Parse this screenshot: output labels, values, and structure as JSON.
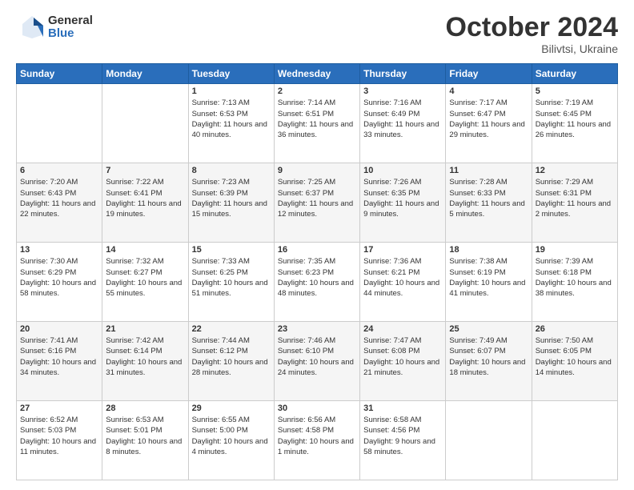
{
  "header": {
    "logo_general": "General",
    "logo_blue": "Blue",
    "title": "October 2024",
    "location": "Bilivtsi, Ukraine"
  },
  "weekdays": [
    "Sunday",
    "Monday",
    "Tuesday",
    "Wednesday",
    "Thursday",
    "Friday",
    "Saturday"
  ],
  "weeks": [
    [
      {
        "day": "",
        "info": ""
      },
      {
        "day": "",
        "info": ""
      },
      {
        "day": "1",
        "info": "Sunrise: 7:13 AM\nSunset: 6:53 PM\nDaylight: 11 hours and 40 minutes."
      },
      {
        "day": "2",
        "info": "Sunrise: 7:14 AM\nSunset: 6:51 PM\nDaylight: 11 hours and 36 minutes."
      },
      {
        "day": "3",
        "info": "Sunrise: 7:16 AM\nSunset: 6:49 PM\nDaylight: 11 hours and 33 minutes."
      },
      {
        "day": "4",
        "info": "Sunrise: 7:17 AM\nSunset: 6:47 PM\nDaylight: 11 hours and 29 minutes."
      },
      {
        "day": "5",
        "info": "Sunrise: 7:19 AM\nSunset: 6:45 PM\nDaylight: 11 hours and 26 minutes."
      }
    ],
    [
      {
        "day": "6",
        "info": "Sunrise: 7:20 AM\nSunset: 6:43 PM\nDaylight: 11 hours and 22 minutes."
      },
      {
        "day": "7",
        "info": "Sunrise: 7:22 AM\nSunset: 6:41 PM\nDaylight: 11 hours and 19 minutes."
      },
      {
        "day": "8",
        "info": "Sunrise: 7:23 AM\nSunset: 6:39 PM\nDaylight: 11 hours and 15 minutes."
      },
      {
        "day": "9",
        "info": "Sunrise: 7:25 AM\nSunset: 6:37 PM\nDaylight: 11 hours and 12 minutes."
      },
      {
        "day": "10",
        "info": "Sunrise: 7:26 AM\nSunset: 6:35 PM\nDaylight: 11 hours and 9 minutes."
      },
      {
        "day": "11",
        "info": "Sunrise: 7:28 AM\nSunset: 6:33 PM\nDaylight: 11 hours and 5 minutes."
      },
      {
        "day": "12",
        "info": "Sunrise: 7:29 AM\nSunset: 6:31 PM\nDaylight: 11 hours and 2 minutes."
      }
    ],
    [
      {
        "day": "13",
        "info": "Sunrise: 7:30 AM\nSunset: 6:29 PM\nDaylight: 10 hours and 58 minutes."
      },
      {
        "day": "14",
        "info": "Sunrise: 7:32 AM\nSunset: 6:27 PM\nDaylight: 10 hours and 55 minutes."
      },
      {
        "day": "15",
        "info": "Sunrise: 7:33 AM\nSunset: 6:25 PM\nDaylight: 10 hours and 51 minutes."
      },
      {
        "day": "16",
        "info": "Sunrise: 7:35 AM\nSunset: 6:23 PM\nDaylight: 10 hours and 48 minutes."
      },
      {
        "day": "17",
        "info": "Sunrise: 7:36 AM\nSunset: 6:21 PM\nDaylight: 10 hours and 44 minutes."
      },
      {
        "day": "18",
        "info": "Sunrise: 7:38 AM\nSunset: 6:19 PM\nDaylight: 10 hours and 41 minutes."
      },
      {
        "day": "19",
        "info": "Sunrise: 7:39 AM\nSunset: 6:18 PM\nDaylight: 10 hours and 38 minutes."
      }
    ],
    [
      {
        "day": "20",
        "info": "Sunrise: 7:41 AM\nSunset: 6:16 PM\nDaylight: 10 hours and 34 minutes."
      },
      {
        "day": "21",
        "info": "Sunrise: 7:42 AM\nSunset: 6:14 PM\nDaylight: 10 hours and 31 minutes."
      },
      {
        "day": "22",
        "info": "Sunrise: 7:44 AM\nSunset: 6:12 PM\nDaylight: 10 hours and 28 minutes."
      },
      {
        "day": "23",
        "info": "Sunrise: 7:46 AM\nSunset: 6:10 PM\nDaylight: 10 hours and 24 minutes."
      },
      {
        "day": "24",
        "info": "Sunrise: 7:47 AM\nSunset: 6:08 PM\nDaylight: 10 hours and 21 minutes."
      },
      {
        "day": "25",
        "info": "Sunrise: 7:49 AM\nSunset: 6:07 PM\nDaylight: 10 hours and 18 minutes."
      },
      {
        "day": "26",
        "info": "Sunrise: 7:50 AM\nSunset: 6:05 PM\nDaylight: 10 hours and 14 minutes."
      }
    ],
    [
      {
        "day": "27",
        "info": "Sunrise: 6:52 AM\nSunset: 5:03 PM\nDaylight: 10 hours and 11 minutes."
      },
      {
        "day": "28",
        "info": "Sunrise: 6:53 AM\nSunset: 5:01 PM\nDaylight: 10 hours and 8 minutes."
      },
      {
        "day": "29",
        "info": "Sunrise: 6:55 AM\nSunset: 5:00 PM\nDaylight: 10 hours and 4 minutes."
      },
      {
        "day": "30",
        "info": "Sunrise: 6:56 AM\nSunset: 4:58 PM\nDaylight: 10 hours and 1 minute."
      },
      {
        "day": "31",
        "info": "Sunrise: 6:58 AM\nSunset: 4:56 PM\nDaylight: 9 hours and 58 minutes."
      },
      {
        "day": "",
        "info": ""
      },
      {
        "day": "",
        "info": ""
      }
    ]
  ]
}
